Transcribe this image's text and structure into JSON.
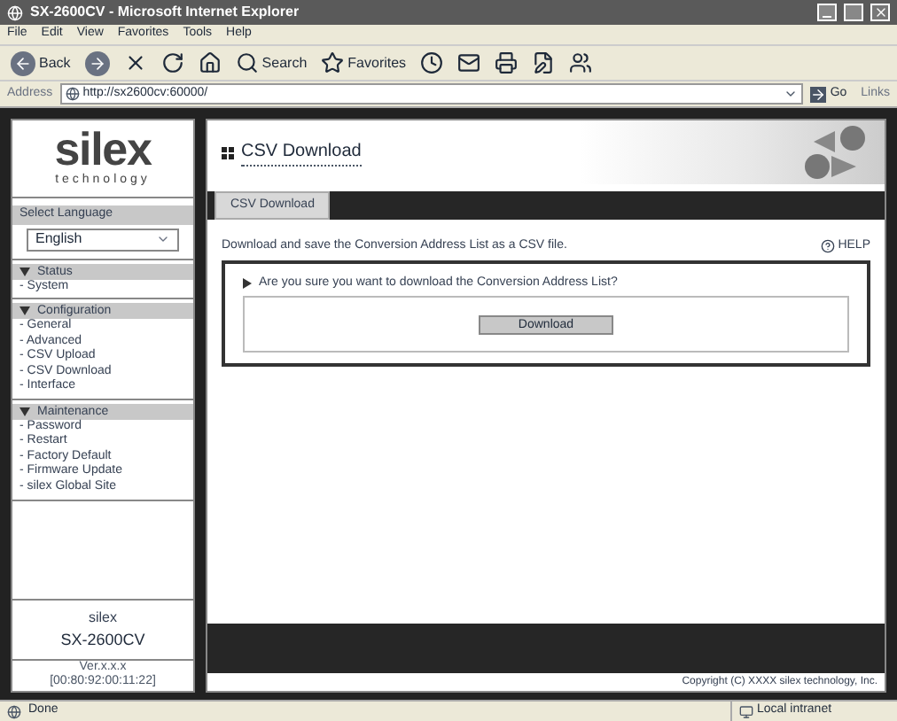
{
  "window": {
    "title": "SX-2600CV - Microsoft Internet Explorer"
  },
  "menu": [
    "File",
    "Edit",
    "View",
    "Favorites",
    "Tools",
    "Help"
  ],
  "toolbar": [
    {
      "kind": "back",
      "label": "Back"
    },
    {
      "kind": "forward"
    },
    {
      "kind": "stop"
    },
    {
      "kind": "refresh"
    },
    {
      "kind": "home"
    },
    {
      "kind": "search",
      "label": "Search"
    },
    {
      "kind": "favorites",
      "label": "Favorites"
    },
    {
      "kind": "history"
    },
    {
      "kind": "mail"
    },
    {
      "kind": "print"
    },
    {
      "kind": "edit"
    },
    {
      "kind": "messenger"
    }
  ],
  "address": {
    "label": "Address",
    "value": "http://sx2600cv:60000/",
    "go": "Go",
    "links": "Links"
  },
  "sidebar": {
    "logo": "silex",
    "logo_sub": "technology",
    "language_label": "Select Language",
    "language": "English",
    "sections": [
      {
        "title": "Status",
        "expanded": true,
        "items": [
          "- System"
        ]
      },
      {
        "title": "Configuration",
        "expanded": true,
        "items": [
          "- General",
          "- Advanced",
          "- CSV Upload",
          "- CSV Download",
          "- Interface"
        ]
      },
      {
        "title": "Maintenance",
        "expanded": true,
        "items": [
          "- Password",
          "- Restart",
          "- Factory Default",
          "- Firmware Update",
          "- silex Global Site"
        ]
      }
    ],
    "device_brand": "silex",
    "device_model": "SX-2600CV",
    "version": "Ver.x.x.x",
    "mac": "[00:80:92:00:11:22]"
  },
  "main": {
    "heading": "CSV Download",
    "tabs": [
      {
        "label": "CSV Download",
        "selected": true
      }
    ],
    "description": "Download and save the Conversion Address List as a CSV file.",
    "help": "HELP",
    "question": "Are you sure you want to download the Conversion Address List?",
    "button": "Download",
    "copyright": "Copyright (C) XXXX silex technology, Inc."
  },
  "status_bar": {
    "text": "Done",
    "zone": "Local intranet"
  }
}
